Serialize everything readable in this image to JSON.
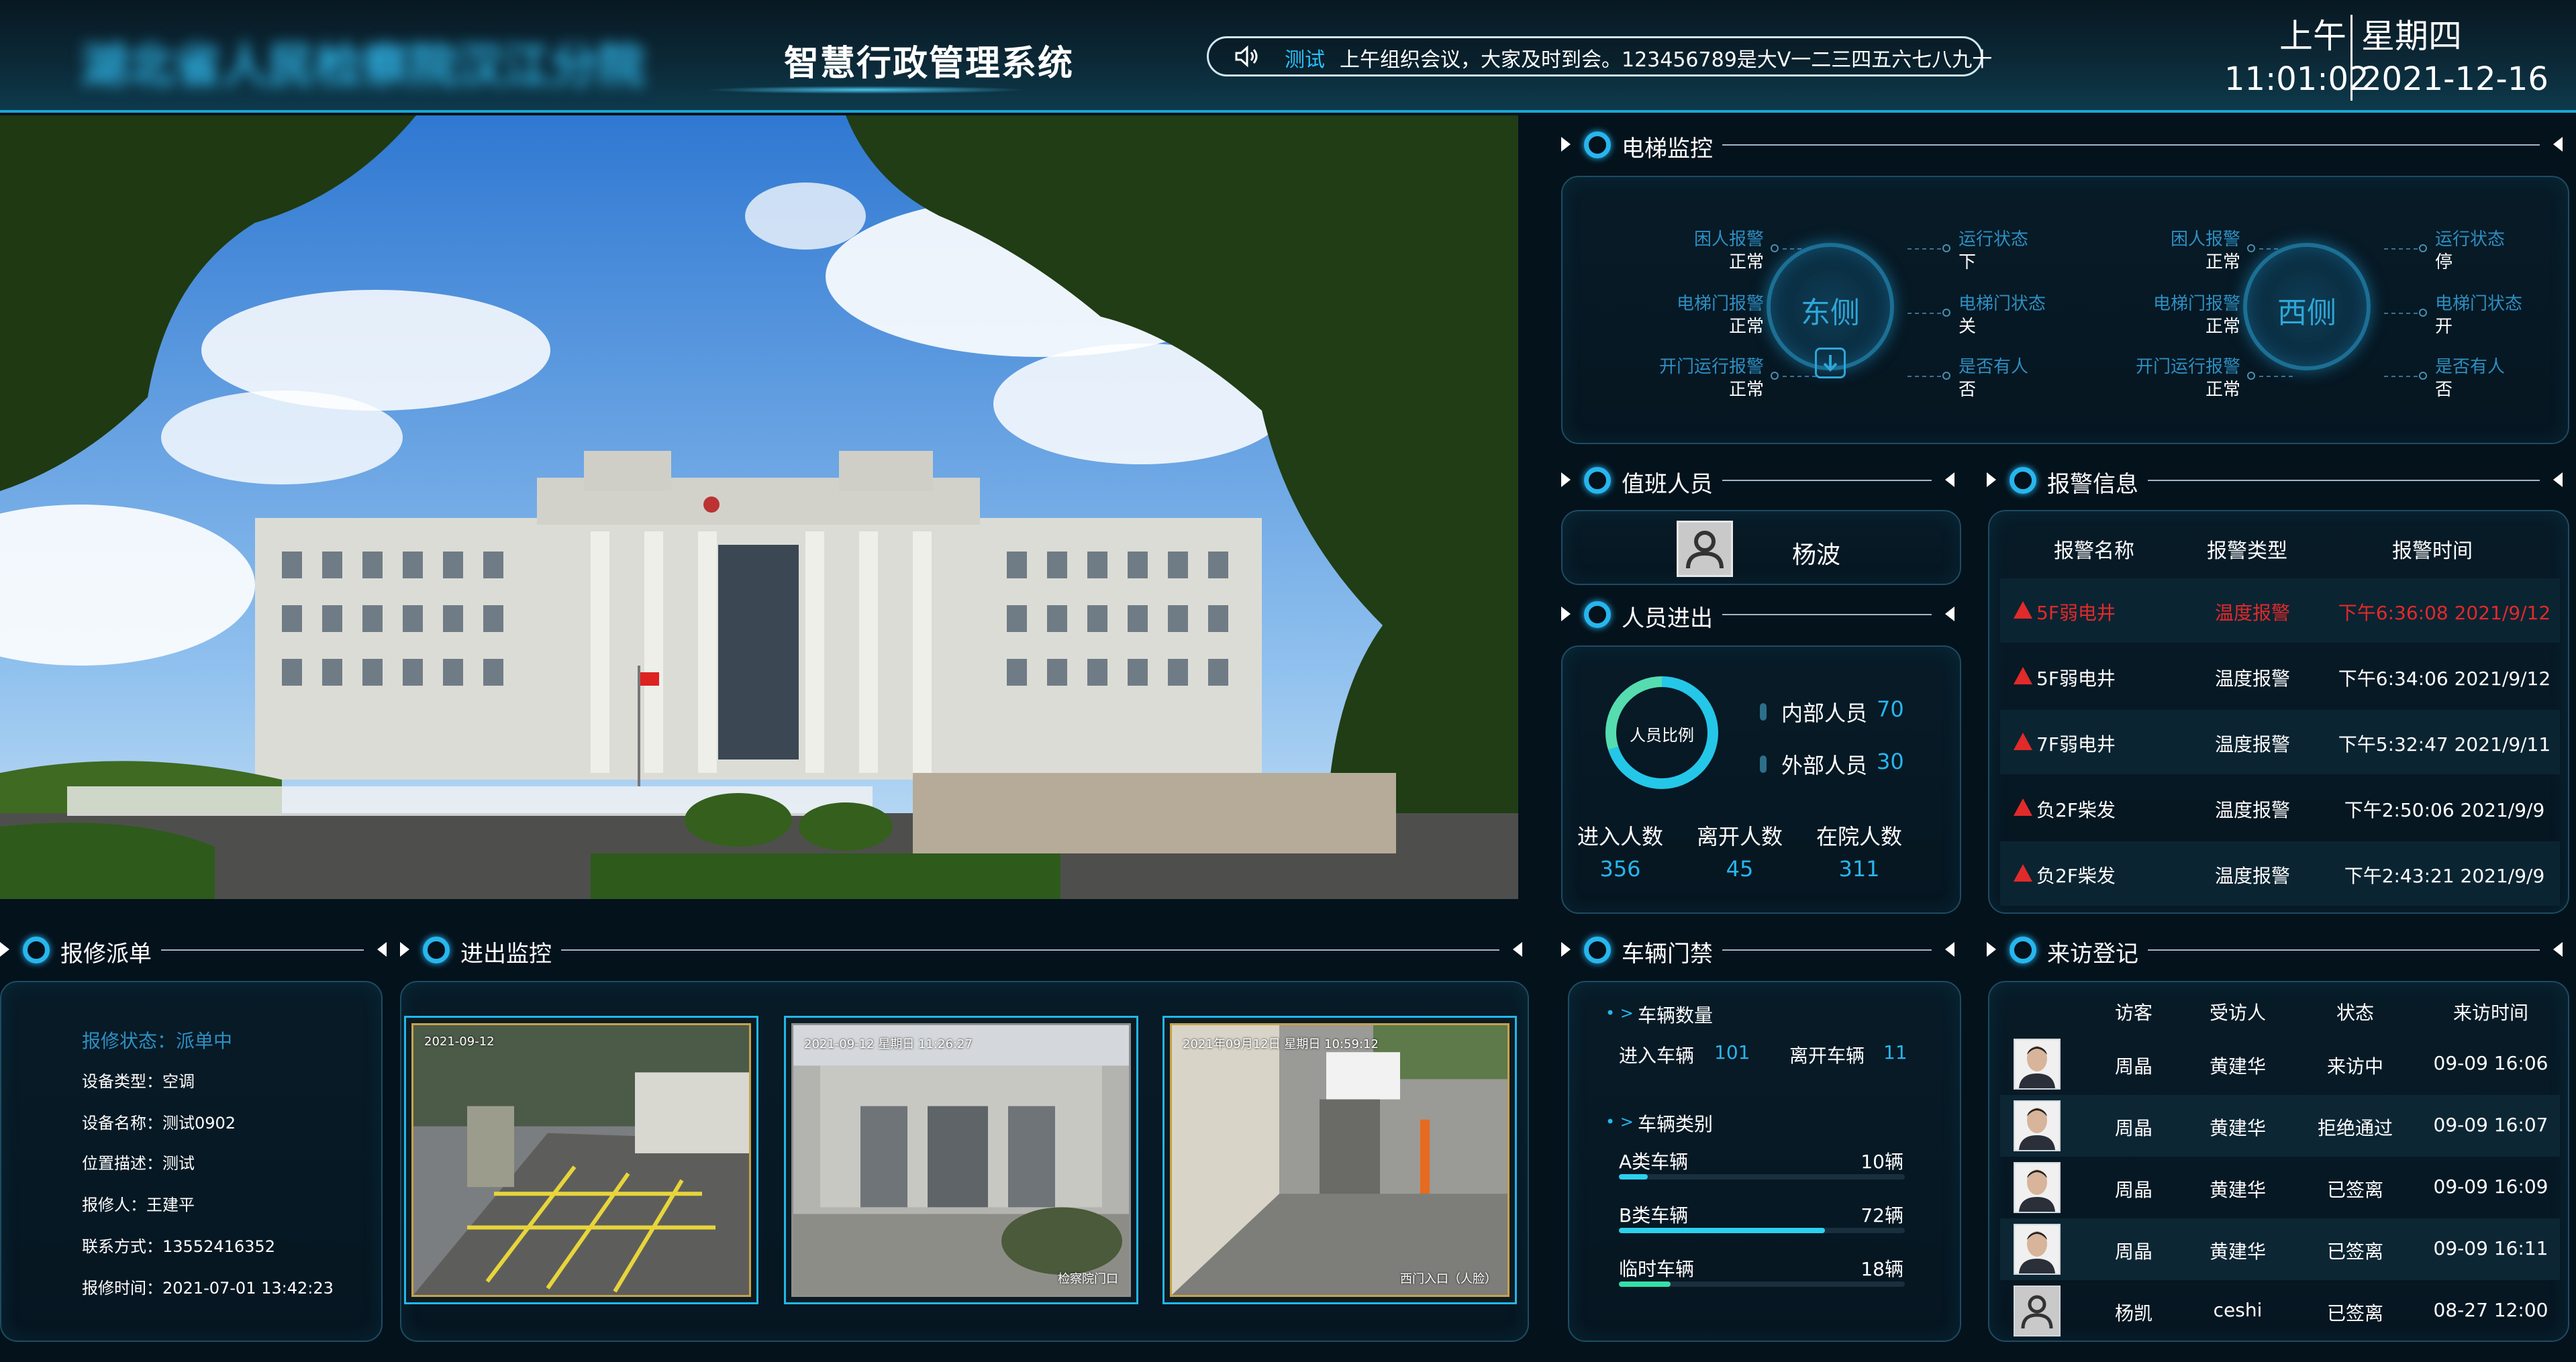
{
  "header": {
    "org_name": "湖北省人民检察院汉江分院",
    "system_title": "智慧行政管理系统",
    "notice_tag": "测试",
    "notice_text": "上午组织会议，大家及时到会。123456789是大V一二三四五六七八九十",
    "ampm": "上午",
    "weekday": "星期四",
    "time": "11:01:02",
    "date": "2021-12-16"
  },
  "elevator": {
    "title": "电梯监控",
    "east": {
      "name": "东侧",
      "left": [
        {
          "label": "困人报警",
          "value": "正常"
        },
        {
          "label": "电梯门报警",
          "value": "正常"
        },
        {
          "label": "开门运行报警",
          "value": "正常"
        }
      ],
      "right": [
        {
          "label": "运行状态",
          "value": "下"
        },
        {
          "label": "电梯门状态",
          "value": "关"
        },
        {
          "label": "是否有人",
          "value": "否"
        }
      ]
    },
    "west": {
      "name": "西侧",
      "left": [
        {
          "label": "困人报警",
          "value": "正常"
        },
        {
          "label": "电梯门报警",
          "value": "正常"
        },
        {
          "label": "开门运行报警",
          "value": "正常"
        }
      ],
      "right": [
        {
          "label": "运行状态",
          "value": "停"
        },
        {
          "label": "电梯门状态",
          "value": "开"
        },
        {
          "label": "是否有人",
          "value": "否"
        }
      ]
    }
  },
  "duty": {
    "title": "值班人员",
    "name": "杨波"
  },
  "people": {
    "title": "人员进出",
    "donut_label": "人员比例",
    "internal_label": "内部人员",
    "internal_value": "70",
    "external_label": "外部人员",
    "external_value": "30",
    "stats": [
      {
        "label": "进入人数",
        "value": "356"
      },
      {
        "label": "离开人数",
        "value": "45"
      },
      {
        "label": "在院人数",
        "value": "311"
      }
    ]
  },
  "alarm": {
    "title": "报警信息",
    "columns": [
      "报警名称",
      "报警类型",
      "报警时间"
    ],
    "rows": [
      {
        "name": "5F弱电井",
        "type": "温度报警",
        "time": "下午6:36:08 2021/9/12",
        "highlight": true
      },
      {
        "name": "5F弱电井",
        "type": "温度报警",
        "time": "下午6:34:06 2021/9/12",
        "highlight": false
      },
      {
        "name": "7F弱电井",
        "type": "温度报警",
        "time": "下午5:32:47 2021/9/11",
        "highlight": false
      },
      {
        "name": "负2F柴发",
        "type": "温度报警",
        "time": "下午2:50:06 2021/9/9",
        "highlight": false
      },
      {
        "name": "负2F柴发",
        "type": "温度报警",
        "time": "下午2:43:21 2021/9/9",
        "highlight": false
      }
    ],
    "colors": {
      "highlight": "#e12a2a",
      "normal": "#ffffff"
    }
  },
  "repair": {
    "title": "报修派单",
    "status": "报修状态：派单中",
    "fields": [
      "设备类型：空调",
      "设备名称：测试0902",
      "位置描述：测试",
      "报修人：王建平",
      "联系方式：13552416352",
      "报修时间：2021-07-01 13:42:23"
    ]
  },
  "access": {
    "title": "进出监控",
    "cameras": [
      {
        "timestamp": "2021-09-12",
        "location": ""
      },
      {
        "timestamp": "2021-09-12 星期日 11:26:27",
        "location": "检察院门口"
      },
      {
        "timestamp": "2021年09月12日 星期日 10:59:12",
        "location": "西门入口（人脸）"
      }
    ]
  },
  "vehicle": {
    "title": "车辆门禁",
    "count_title": "车辆数量",
    "enter_label": "进入车辆",
    "enter_value": "101",
    "leave_label": "离开车辆",
    "leave_value": "11",
    "category_title": "车辆类别",
    "categories": [
      {
        "label": "A类车辆",
        "value": "10辆",
        "fraction": 0.1
      },
      {
        "label": "B类车辆",
        "value": "72辆",
        "fraction": 0.72
      },
      {
        "label": "临时车辆",
        "value": "18辆",
        "fraction": 0.18
      }
    ]
  },
  "visitor": {
    "title": "来访登记",
    "columns": [
      "访客",
      "受访人",
      "状态",
      "来访时间"
    ],
    "rows": [
      {
        "visitor": "周晶",
        "host": "黄建华",
        "status": "来访中",
        "time": "09-09 16:06",
        "avatar": "photo"
      },
      {
        "visitor": "周晶",
        "host": "黄建华",
        "status": "拒绝通过",
        "time": "09-09 16:07",
        "avatar": "photo"
      },
      {
        "visitor": "周晶",
        "host": "黄建华",
        "status": "已签离",
        "time": "09-09 16:09",
        "avatar": "photo"
      },
      {
        "visitor": "周晶",
        "host": "黄建华",
        "status": "已签离",
        "time": "09-09 16:11",
        "avatar": "photo"
      },
      {
        "visitor": "杨凯",
        "host": "ceshi",
        "status": "已签离",
        "time": "08-27 12:00",
        "avatar": "placeholder"
      }
    ]
  },
  "icons": {
    "speaker": "speaker-icon",
    "down_arrow": "down-arrow-icon",
    "user_placeholder": "user-avatar-icon",
    "alarm_triangle": "warning-triangle-icon"
  },
  "colors": {
    "accent": "#27b6ee",
    "label_blue": "#2e8fc2",
    "alarm_red": "#e12a2a",
    "bar_fill": "#2bd1ee"
  }
}
